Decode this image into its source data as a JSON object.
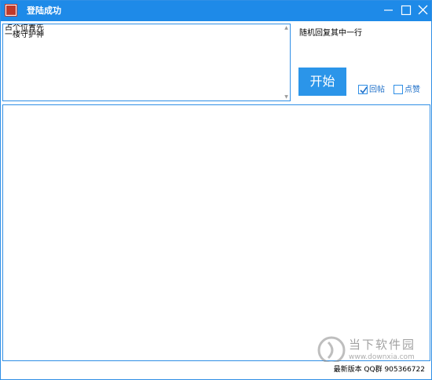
{
  "window": {
    "title": "登陆成功",
    "app_icon": "qq-seal-icon",
    "accent_color": "#1e8ae8",
    "controls": {
      "minimize": "minimize-icon",
      "maximize": "maximize-icon",
      "close": "close-icon"
    }
  },
  "input_panel": {
    "value": "占个位置先\n一楼守护神",
    "scroll_up_icon": "scroll-up-arrow-icon",
    "scroll_down_icon": "scroll-down-arrow-icon"
  },
  "options": {
    "random_reply_label": "随机回复其中一行",
    "start_button_label": "开始",
    "start_button_color": "#2b95e9",
    "reply_checkbox": {
      "label": "回帖",
      "checked": true
    },
    "like_checkbox": {
      "label": "点赞",
      "checked": false
    }
  },
  "log_panel": {
    "value": ""
  },
  "status": {
    "version_text": "最新版本 QQ群 905366722"
  },
  "watermark": {
    "name": "当下软件园",
    "url": "www.downxia.com"
  }
}
